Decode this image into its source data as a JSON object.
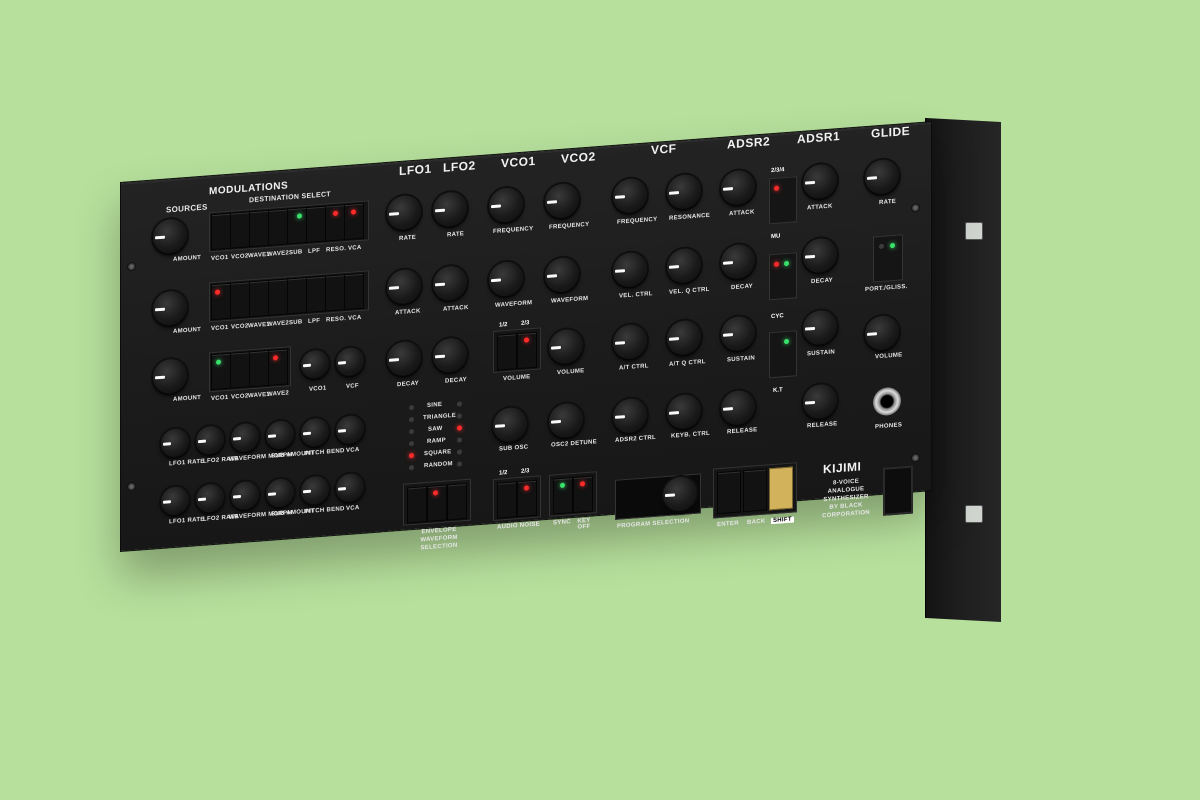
{
  "device": {
    "brand_name": "KIJIMI",
    "description": "8-VOICE ANALOGUE SYNTHESIZER BY BLACK CORPORATION",
    "colors": {
      "background": "#b7e09c",
      "panel": "#1c1c1c",
      "led_red": "#ff2b2b",
      "led_green": "#39e06a",
      "shift_key": "#d2b25a"
    }
  },
  "modulation": {
    "sources_label": "SOURCES",
    "title": "MODULATIONS",
    "dest_label": "DESTINATION SELECT",
    "amount_label": "AMOUNT",
    "row1_dest": [
      "VCO1",
      "VCO2",
      "WAVE1",
      "WAVE2",
      "SUB",
      "LPF",
      "RESO.",
      "VCA"
    ],
    "row3_dest": [
      "VCO1",
      "VCO2",
      "WAVE1",
      "WAVE2"
    ],
    "row3_knobs": [
      "VCO1",
      "VCF"
    ],
    "row4_labels": [
      "LFO1 RATE",
      "LFO2 RATE",
      "WAVEFORM MORPH",
      "SUB AMOUNT",
      "PITCH BEND",
      "VCA"
    ]
  },
  "lfo": {
    "lfo1": "LFO1",
    "lfo2": "LFO2",
    "rate": "RATE",
    "attack": "ATTACK",
    "decay": "DECAY",
    "waveforms": [
      "SINE",
      "TRIANGLE",
      "SAW",
      "RAMP",
      "SQUARE",
      "RANDOM"
    ],
    "waveform_selection": "ENVELOPE WAVEFORM SELECTION"
  },
  "vco": {
    "vco1": "VCO1",
    "vco2": "VCO2",
    "frequency": "FREQUENCY",
    "waveform": "WAVEFORM",
    "volume": "VOLUME",
    "sub_osc": "SUB OSC",
    "osc2_detune": "OSC2 DETUNE",
    "ratio_a": "1/2",
    "ratio_b": "2/3",
    "audio_noise": "AUDIO NOISE",
    "sync": "SYNC",
    "key_off": "KEY OFF"
  },
  "vcf": {
    "title": "VCF",
    "frequency": "FREQUENCY",
    "resonance": "RESONANCE",
    "vel_ctrl": "VEL. CTRL",
    "vel_q_ctrl": "VEL. Q CTRL",
    "at_ctrl": "A/T CTRL",
    "at_q_ctrl": "A/T Q CTRL",
    "adsr2_ctrl": "ADSR2 CTRL",
    "keyb_ctrl": "KEYB. CTRL"
  },
  "adsr2": {
    "title": "ADSR2",
    "attack": "ATTACK",
    "decay": "DECAY",
    "sustain": "SUSTAIN",
    "release": "RELEASE"
  },
  "adsr1": {
    "title": "ADSR1",
    "attack": "ATTACK",
    "decay": "DECAY",
    "sustain": "SUSTAIN",
    "release": "RELEASE",
    "side_labels": [
      "2/3/4",
      "MU",
      "CYC",
      "K.T"
    ]
  },
  "glide": {
    "title": "GLIDE",
    "rate": "RATE",
    "port_gliss": "PORT./GLISS.",
    "volume": "VOLUME",
    "phones": "PHONES"
  },
  "program": {
    "selection": "PROGRAM SELECTION",
    "enter": "ENTER",
    "back": "BACK",
    "shift": "SHIFT"
  }
}
